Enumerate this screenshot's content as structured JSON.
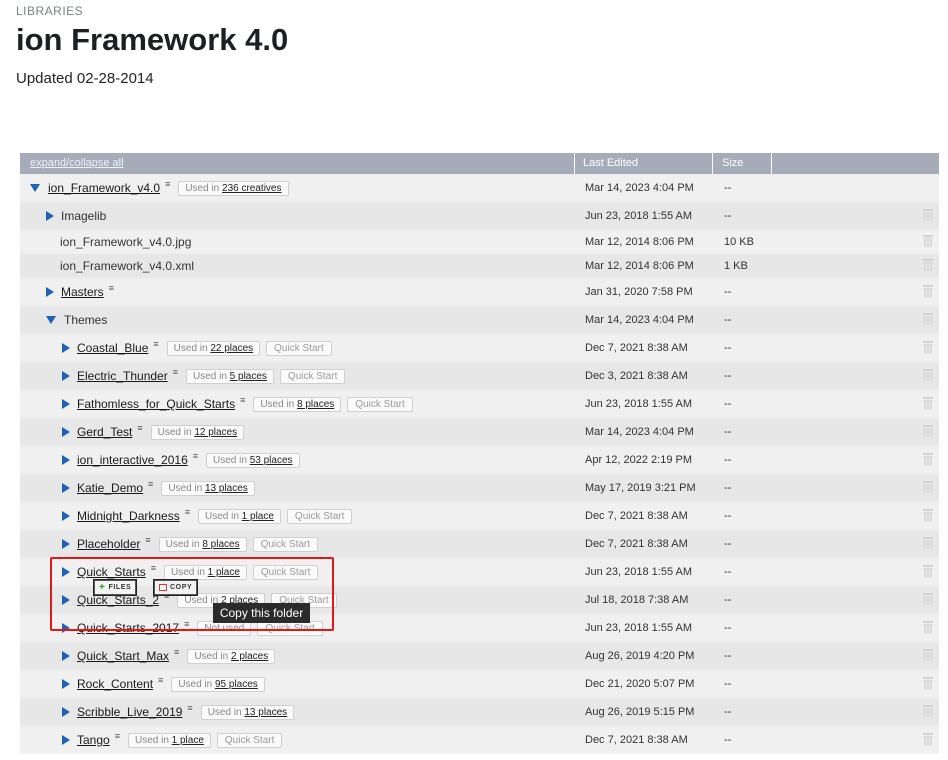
{
  "breadcrumb": "LIBRARIES",
  "title": "ion Framework 4.0",
  "updated": "Updated 02-28-2014",
  "table": {
    "col_name": "expand/collapse all",
    "col_edited": "Last Edited",
    "col_size": "Size"
  },
  "rows": [
    {
      "name": "ion_Framework_v4.0",
      "edited": "Mar 14, 2023 4:04 PM",
      "size": "--",
      "used_pre": "Used in",
      "used_link": "236 creatives"
    },
    {
      "name": "Imagelib",
      "edited": "Jun 23, 2018 1:55 AM",
      "size": "--"
    },
    {
      "name": "ion_Framework_v4.0.jpg",
      "edited": "Mar 12, 2014 8:06 PM",
      "size": "10 KB"
    },
    {
      "name": "ion_Framework_v4.0.xml",
      "edited": "Mar 12, 2014 8:06 PM",
      "size": "1 KB"
    },
    {
      "name": "Masters",
      "edited": "Jan 31, 2020 7:58 PM",
      "size": "--"
    },
    {
      "name": "Themes",
      "edited": "Mar 14, 2023 4:04 PM",
      "size": "--"
    },
    {
      "name": "Coastal_Blue",
      "edited": "Dec 7, 2021 8:38 AM",
      "size": "--",
      "used_pre": "Used in",
      "used_link": "22 places",
      "qs": "Quick Start"
    },
    {
      "name": "Electric_Thunder",
      "edited": "Dec 3, 2021 8:38 AM",
      "size": "--",
      "used_pre": "Used in",
      "used_link": "5 places",
      "qs": "Quick Start"
    },
    {
      "name": "Fathomless_for_Quick_Starts",
      "edited": "Jun 23, 2018 1:55 AM",
      "size": "--",
      "used_pre": "Used in",
      "used_link": "8 places",
      "qs": "Quick Start"
    },
    {
      "name": "Gerd_Test",
      "edited": "Mar 14, 2023 4:04 PM",
      "size": "--",
      "used_pre": "Used in",
      "used_link": "12 places"
    },
    {
      "name": "ion_interactive_2016",
      "edited": "Apr 12, 2022 2:19 PM",
      "size": "--",
      "used_pre": "Used in",
      "used_link": "53 places"
    },
    {
      "name": "Katie_Demo",
      "edited": "May 17, 2019 3:21 PM",
      "size": "--",
      "used_pre": "Used in",
      "used_link": "13 places"
    },
    {
      "name": "Midnight_Darkness",
      "edited": "Dec 7, 2021 8:38 AM",
      "size": "--",
      "used_pre": "Used in",
      "used_link": "1 place",
      "qs": "Quick Start"
    },
    {
      "name": "Placeholder",
      "edited": "Dec 7, 2021 8:38 AM",
      "size": "--",
      "used_pre": "Used in",
      "used_link": "8 places",
      "qs": "Quick Start"
    },
    {
      "name": "Quick_Starts",
      "edited": "Jun 23, 2018 1:55 AM",
      "size": "--",
      "used_pre": "Used in",
      "used_link": "1 place",
      "qs": "Quick Start"
    },
    {
      "name": "Quick_Starts_2",
      "edited": "Jul 18, 2018 7:38 AM",
      "size": "--",
      "used_pre": "Used in",
      "used_link": "2 places",
      "qs": "Quick Start"
    },
    {
      "name": "Quick_Starts_2017",
      "edited": "Jun 23, 2018 1:55 AM",
      "size": "--",
      "used_pre": "Not used",
      "qs": "Quick Start"
    },
    {
      "name": "Quick_Start_Max",
      "edited": "Aug 26, 2019 4:20 PM",
      "size": "--",
      "used_pre": "Used in",
      "used_link": "2 places"
    },
    {
      "name": "Rock_Content",
      "edited": "Dec 21, 2020 5:07 PM",
      "size": "--",
      "used_pre": "Used in",
      "used_link": "95 places"
    },
    {
      "name": "Scribble_Live_2019",
      "edited": "Aug 26, 2019 5:15 PM",
      "size": "--",
      "used_pre": "Used in",
      "used_link": "13 places"
    },
    {
      "name": "Tango",
      "edited": "Dec 7, 2021 8:38 AM",
      "size": "--",
      "used_pre": "Used in",
      "used_link": "1 place",
      "qs": "Quick Start"
    }
  ],
  "hover_actions": {
    "files": "FILES",
    "copy": "COPY"
  },
  "tooltip": "Copy this folder",
  "colors": {
    "header_bg": "#a4acb9",
    "triangle": "#1d62b8",
    "highlight": "#e01818"
  }
}
